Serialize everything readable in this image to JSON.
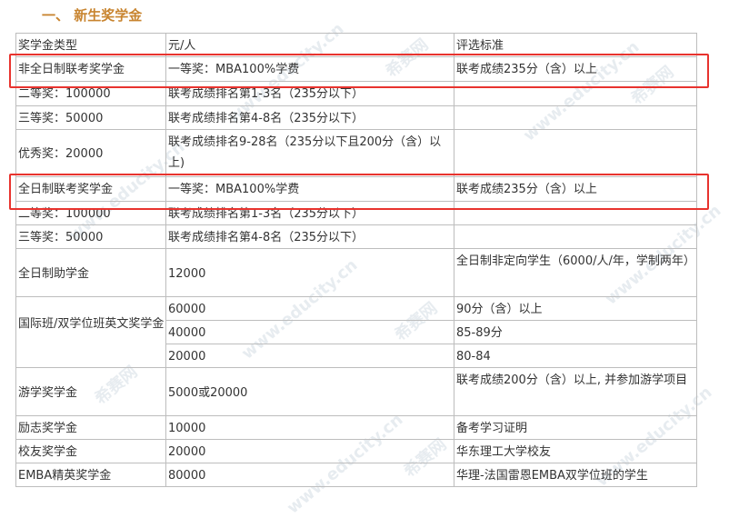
{
  "heading": "一、 新生奖学金",
  "header": {
    "c1": "奖学金类型",
    "c2": "元/人",
    "c3": "评选标准"
  },
  "rows": {
    "r1": {
      "c1": "非全日制联考奖学金",
      "c2": "一等奖：MBA100%学费",
      "c3": "联考成绩235分（含）以上"
    },
    "r2": {
      "c1": "二等奖：100000",
      "c2": "联考成绩排名第1-3名（235分以下）",
      "c3": ""
    },
    "r3": {
      "c1": "三等奖：50000",
      "c2": "联考成绩排名第4-8名（235分以下）",
      "c3": ""
    },
    "r4": {
      "c1": "优秀奖：20000",
      "c2": "联考成绩排名9-28名（235分以下且200分（含）以上)",
      "c3": ""
    },
    "r5": {
      "c1": "全日制联考奖学金",
      "c2": "一等奖：MBA100%学费",
      "c3": "联考成绩235分（含）以上"
    },
    "r6": {
      "c1": "二等奖：100000",
      "c2": "联考成绩排名第1-3名（235分以下）",
      "c3": ""
    },
    "r7": {
      "c1": "三等奖：50000",
      "c2": "联考成绩排名第4-8名（235分以下）",
      "c3": ""
    },
    "r8": {
      "c1": "全日制助学金",
      "c2": "12000",
      "c3": "全日制非定向学生（6000/人/年，学制两年）"
    },
    "r9": {
      "c1": "国际班/双学位班英文奖学金",
      "c2": "60000",
      "c3": "90分（含）以上"
    },
    "r10": {
      "c2": "40000",
      "c3": "85-89分"
    },
    "r11": {
      "c2": "20000",
      "c3": "80-84"
    },
    "r12": {
      "c1": "游学奖学金",
      "c2": "5000或20000",
      "c3": "联考成绩200分（含）以上, 并参加游学项目"
    },
    "r13": {
      "c1": "励志奖学金",
      "c2": "10000",
      "c3": "备考学习证明"
    },
    "r14": {
      "c1": "校友奖学金",
      "c2": "20000",
      "c3": "华东理工大学校友"
    },
    "r15": {
      "c1": "EMBA精英奖学金",
      "c2": "80000",
      "c3": "华理-法国雷恩EMBA双学位班的学生"
    }
  },
  "watermark": {
    "brand": "希赛网",
    "url": "www.educity.cn"
  },
  "colors": {
    "heading": "#c8842f",
    "highlight": "#e8332e",
    "border": "#bdbdbd"
  }
}
